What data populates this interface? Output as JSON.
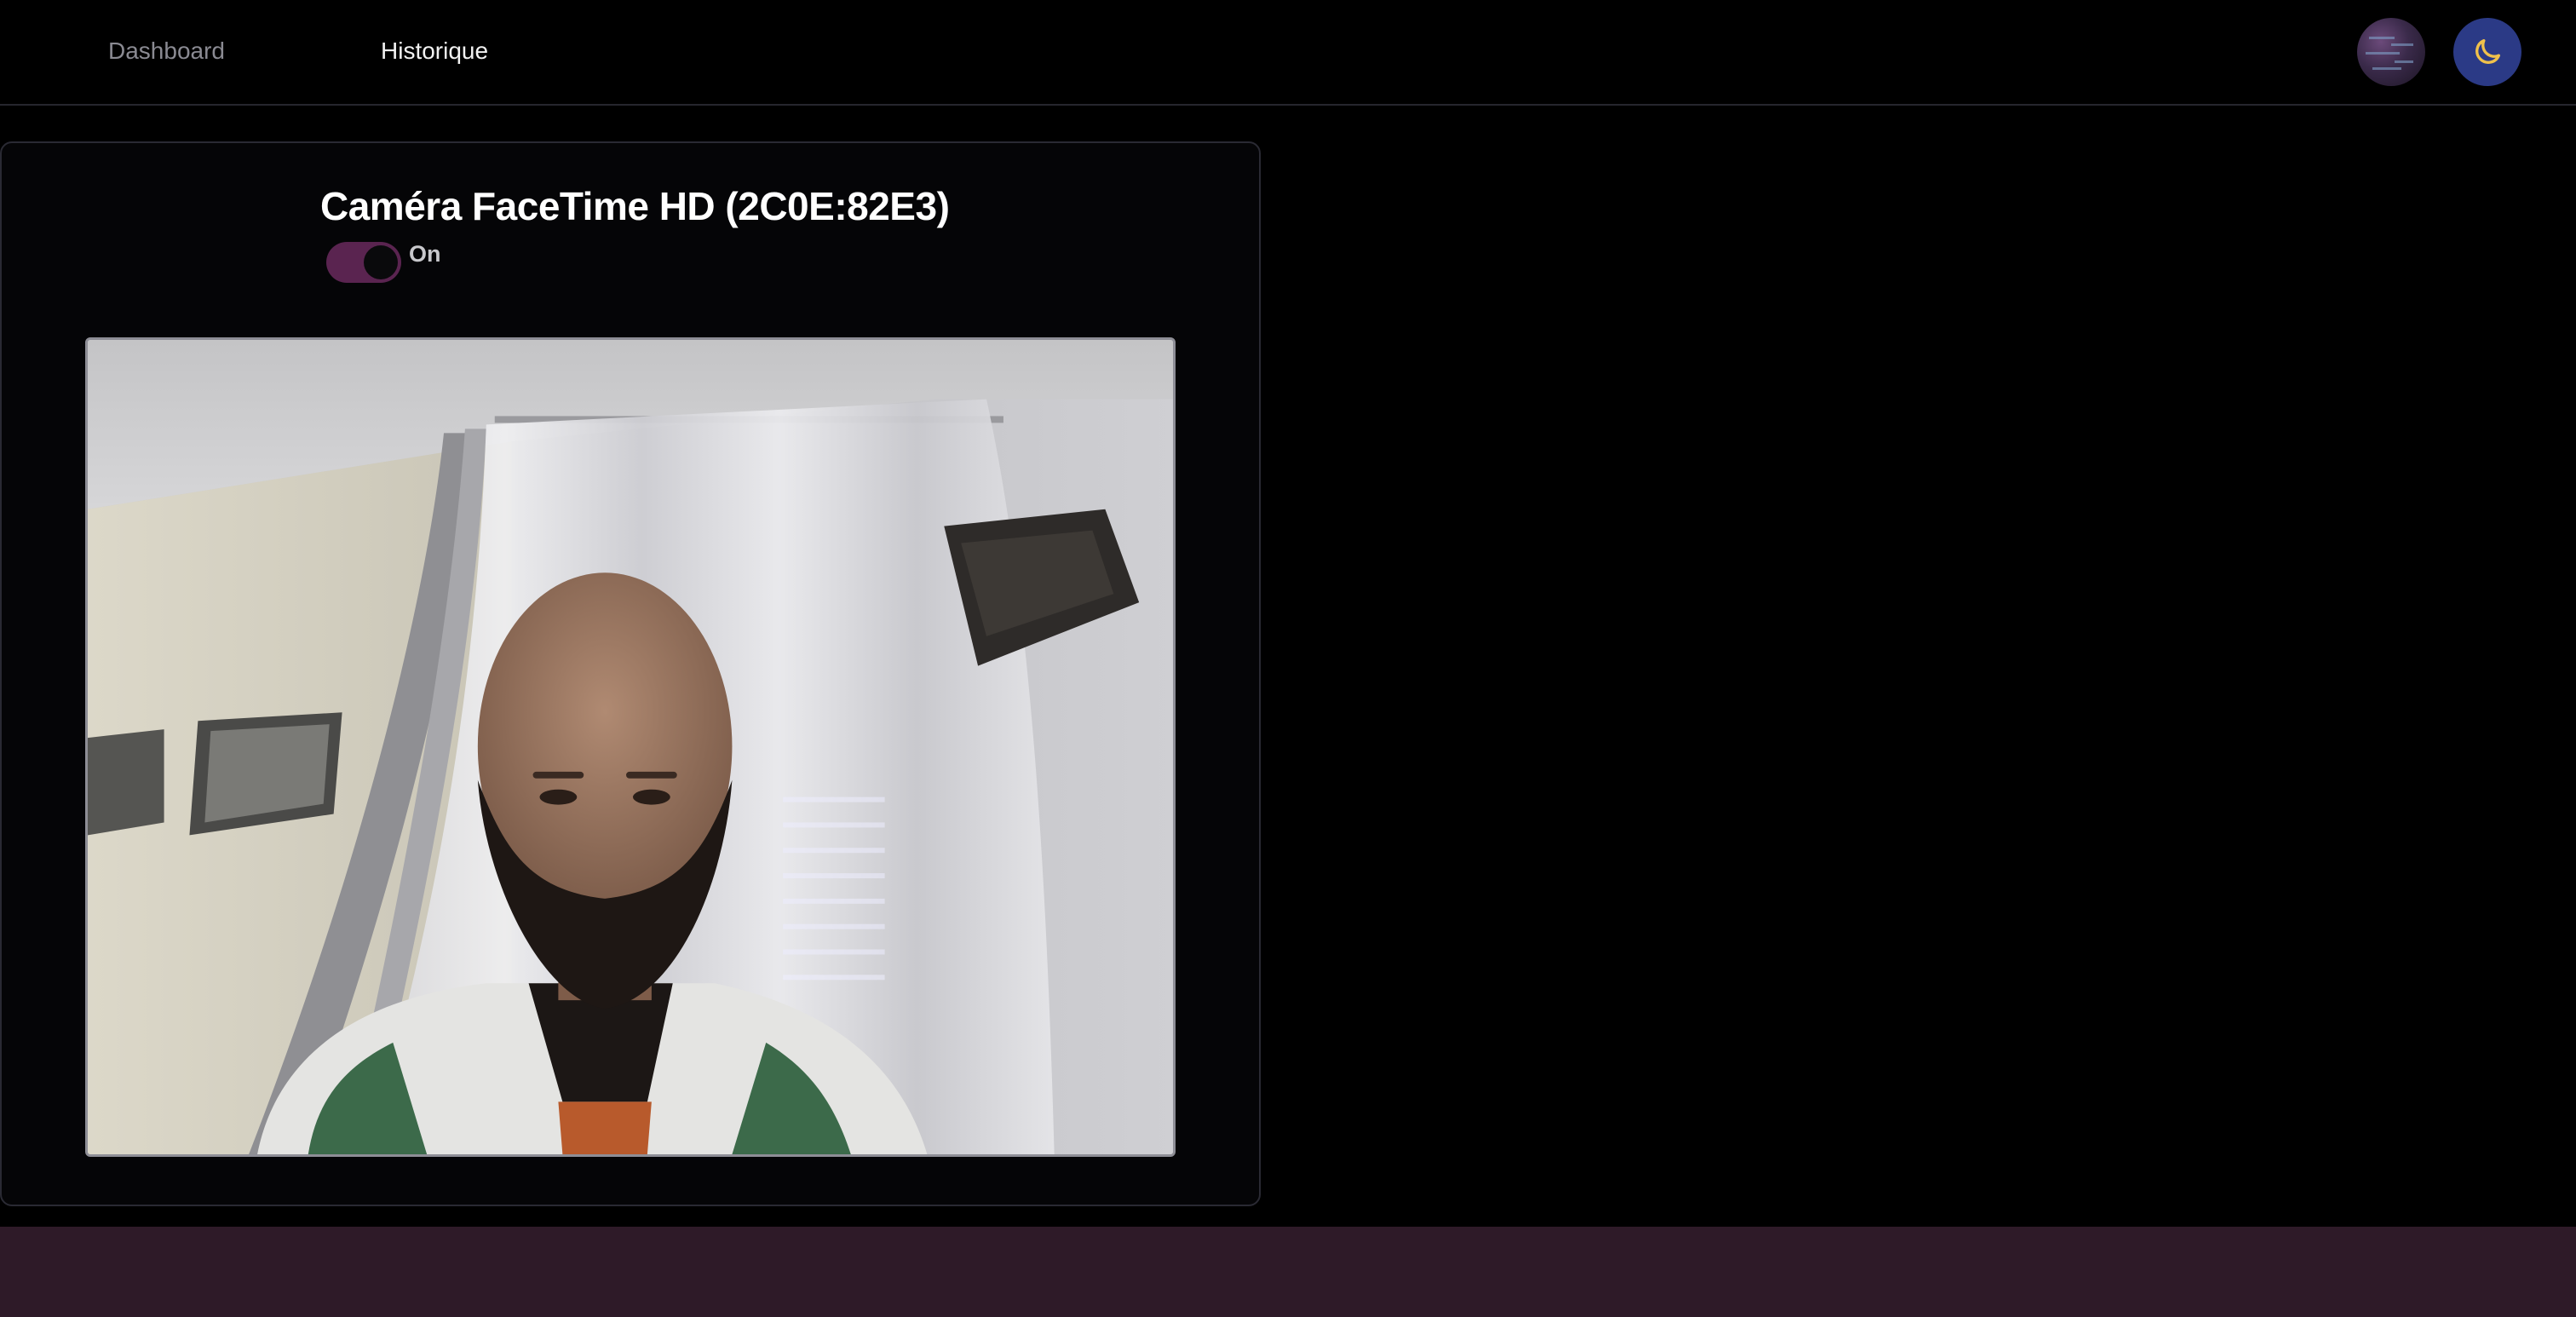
{
  "nav": {
    "items": [
      {
        "label": "Dashboard",
        "active": false
      },
      {
        "label": "Historique",
        "active": true
      }
    ]
  },
  "header": {
    "avatar_icon": "user-avatar",
    "theme_toggle_icon": "moon-icon",
    "theme_toggle_color": "#2b3a86",
    "moon_color": "#f0c14b"
  },
  "camera": {
    "title": "Caméra FaceTime HD (2C0E:82E3)",
    "toggle_state": "On",
    "toggle_on": true,
    "toggle_color": "#5a2450",
    "feed_description_icon": "webcam-feed"
  },
  "footer": {
    "color": "#2e1a28"
  }
}
